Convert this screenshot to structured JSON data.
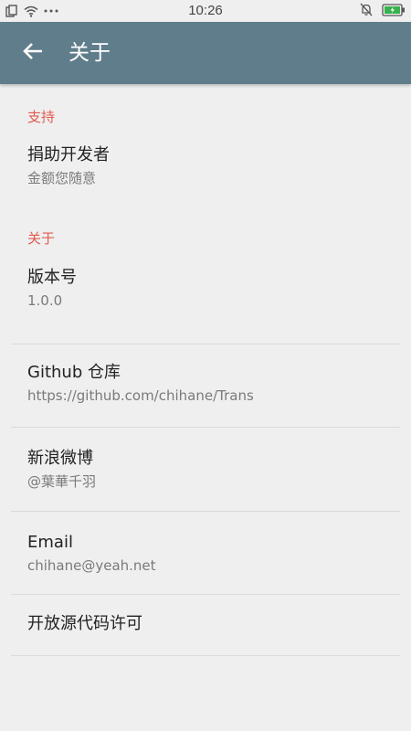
{
  "status_bar": {
    "time": "10:26",
    "icons": [
      "copy-icon",
      "wifi-icon",
      "more-dots-icon",
      "mute-bell-icon",
      "battery-charging-icon"
    ]
  },
  "app_bar": {
    "back_icon": "arrow-left-icon",
    "title": "关于"
  },
  "sections": [
    {
      "header": "支持",
      "items": [
        {
          "title": "捐助开发者",
          "summary": "金额您随意"
        }
      ]
    },
    {
      "header": "关于",
      "items": [
        {
          "title": "版本号",
          "summary": "1.0.0"
        },
        {
          "title": "Github 仓库",
          "summary": "https://github.com/chihane/Trans"
        },
        {
          "title": "新浪微博",
          "summary": "@葉華千羽"
        },
        {
          "title": "Email",
          "summary": "chihane@yeah.net"
        },
        {
          "title": "开放源代码许可",
          "summary": ""
        }
      ]
    }
  ],
  "colors": {
    "app_bar": "#607d8b",
    "section_header": "#e25a4f",
    "background": "#efefef"
  }
}
